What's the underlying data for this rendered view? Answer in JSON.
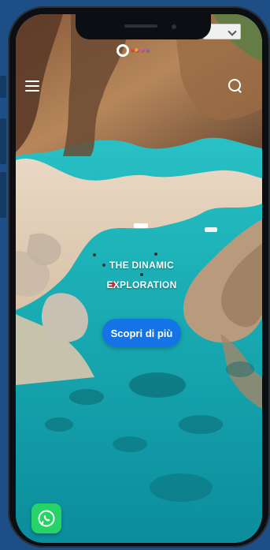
{
  "hero": {
    "title_line1": "THE DINAMIC",
    "title_line2": "EXPLORATION",
    "cta_label": "Scopri di più"
  },
  "colors": {
    "accent": "#1473e6",
    "whatsapp": "#25d366"
  },
  "icons": {
    "menu": "hamburger-menu-icon",
    "search": "search-icon",
    "chevron": "chevron-down-icon",
    "whatsapp": "whatsapp-icon"
  }
}
